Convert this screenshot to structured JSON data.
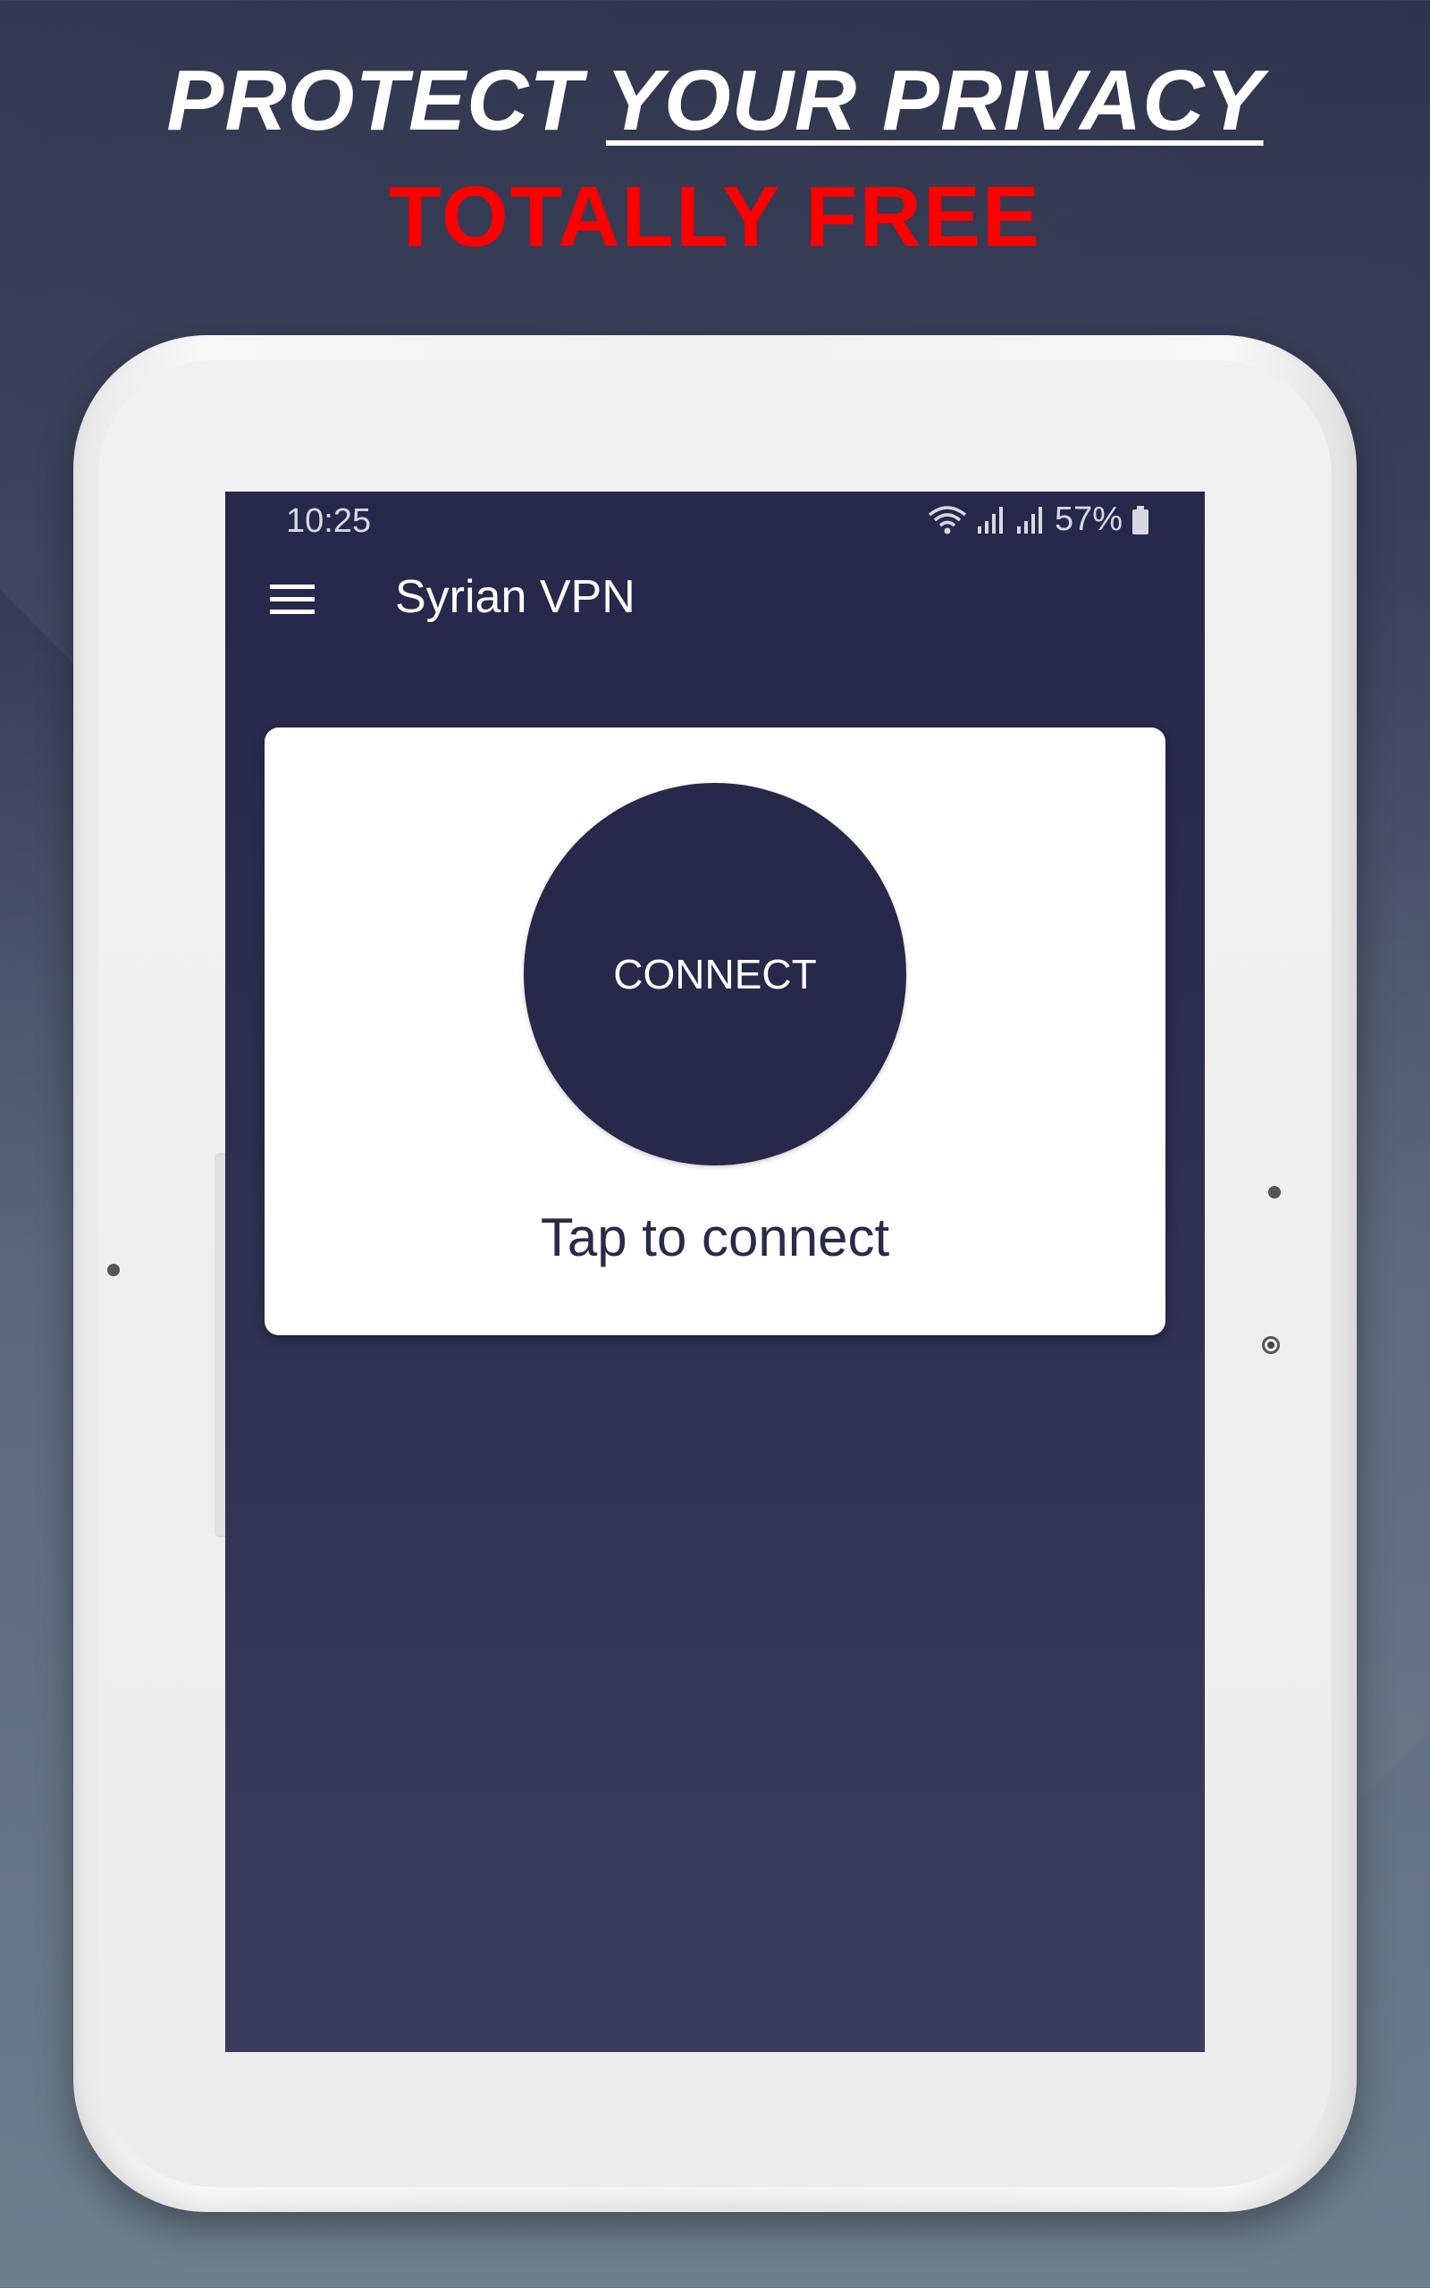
{
  "headline": {
    "line1_part1": "PROTECT ",
    "line1_part2": "YOUR PRIVACY",
    "line2": "TOTALLY FREE"
  },
  "status_bar": {
    "time": "10:25",
    "battery": "57%",
    "icons": [
      "wifi-icon",
      "signal-icon",
      "signal-icon",
      "battery-icon"
    ]
  },
  "app_bar": {
    "title": "Syrian VPN",
    "menu_icon": "hamburger-menu-icon"
  },
  "main": {
    "connect_label": "CONNECT",
    "status_text": "Tap to connect"
  },
  "colors": {
    "headline_accent": "#ff0000",
    "app_primary": "#28284b",
    "card_background": "#ffffff"
  }
}
